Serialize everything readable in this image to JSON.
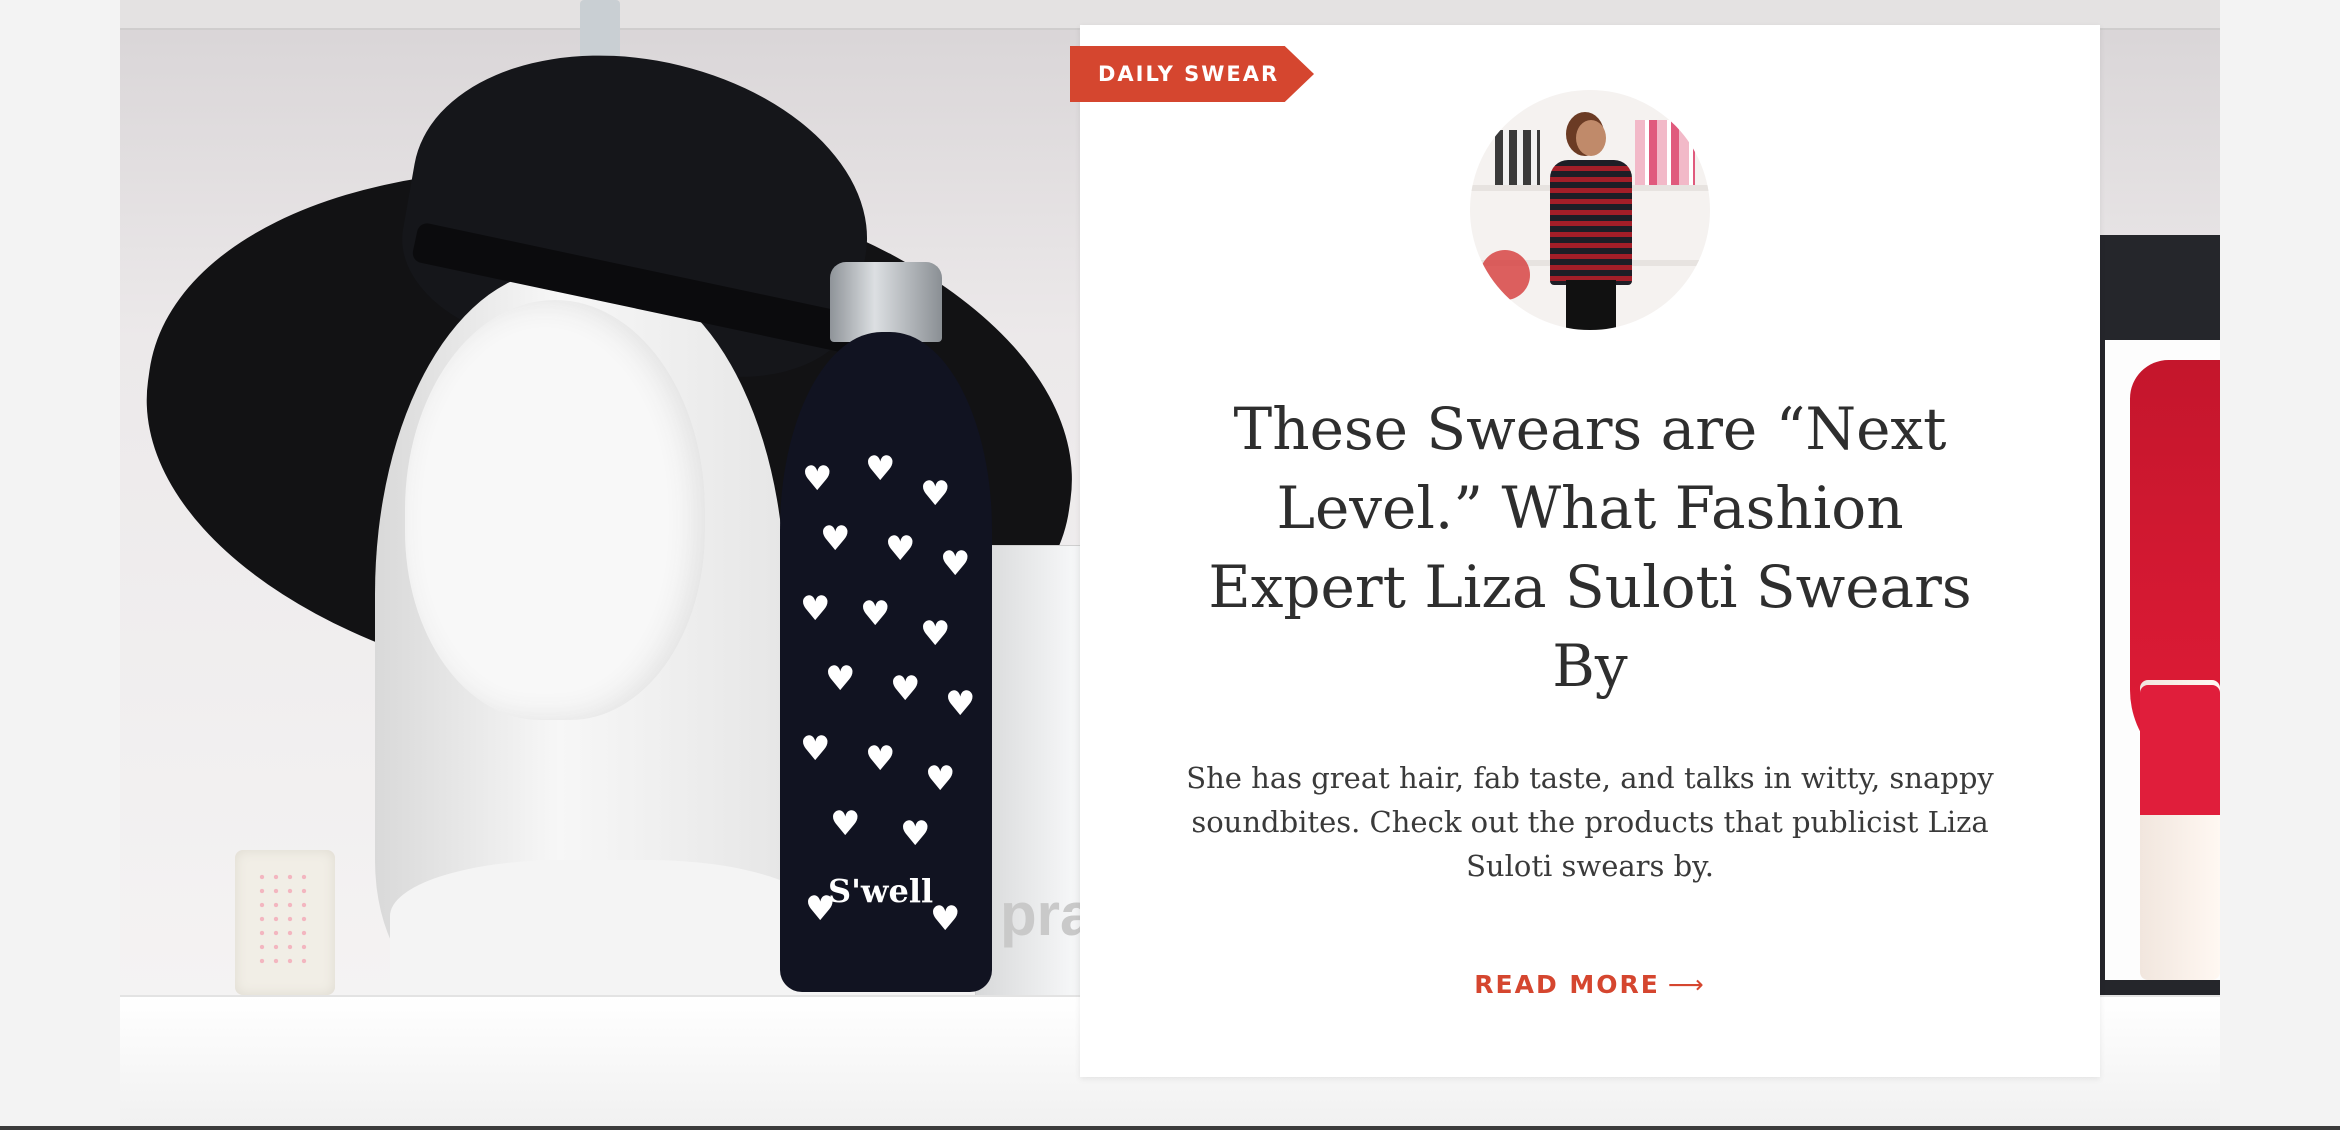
{
  "article": {
    "category": "DAILY SWEAR",
    "title": "These Swears are “Next Level.” What Fashion Expert Liza Suloti Swears By",
    "excerpt": "She has great hair, fab taste, and talks in witty, snappy soundbites. Check out the products that publicist Liza Suloti swears by.",
    "read_more_label": "READ MORE",
    "read_more_arrow": "⟶"
  },
  "hero": {
    "bottle_brand": "S'well",
    "box_text": "pra"
  },
  "colors": {
    "accent": "#d5462f",
    "text": "#2e2e2e",
    "card": "#ffffff"
  },
  "icons": {
    "arrow": "arrow-right-icon"
  }
}
